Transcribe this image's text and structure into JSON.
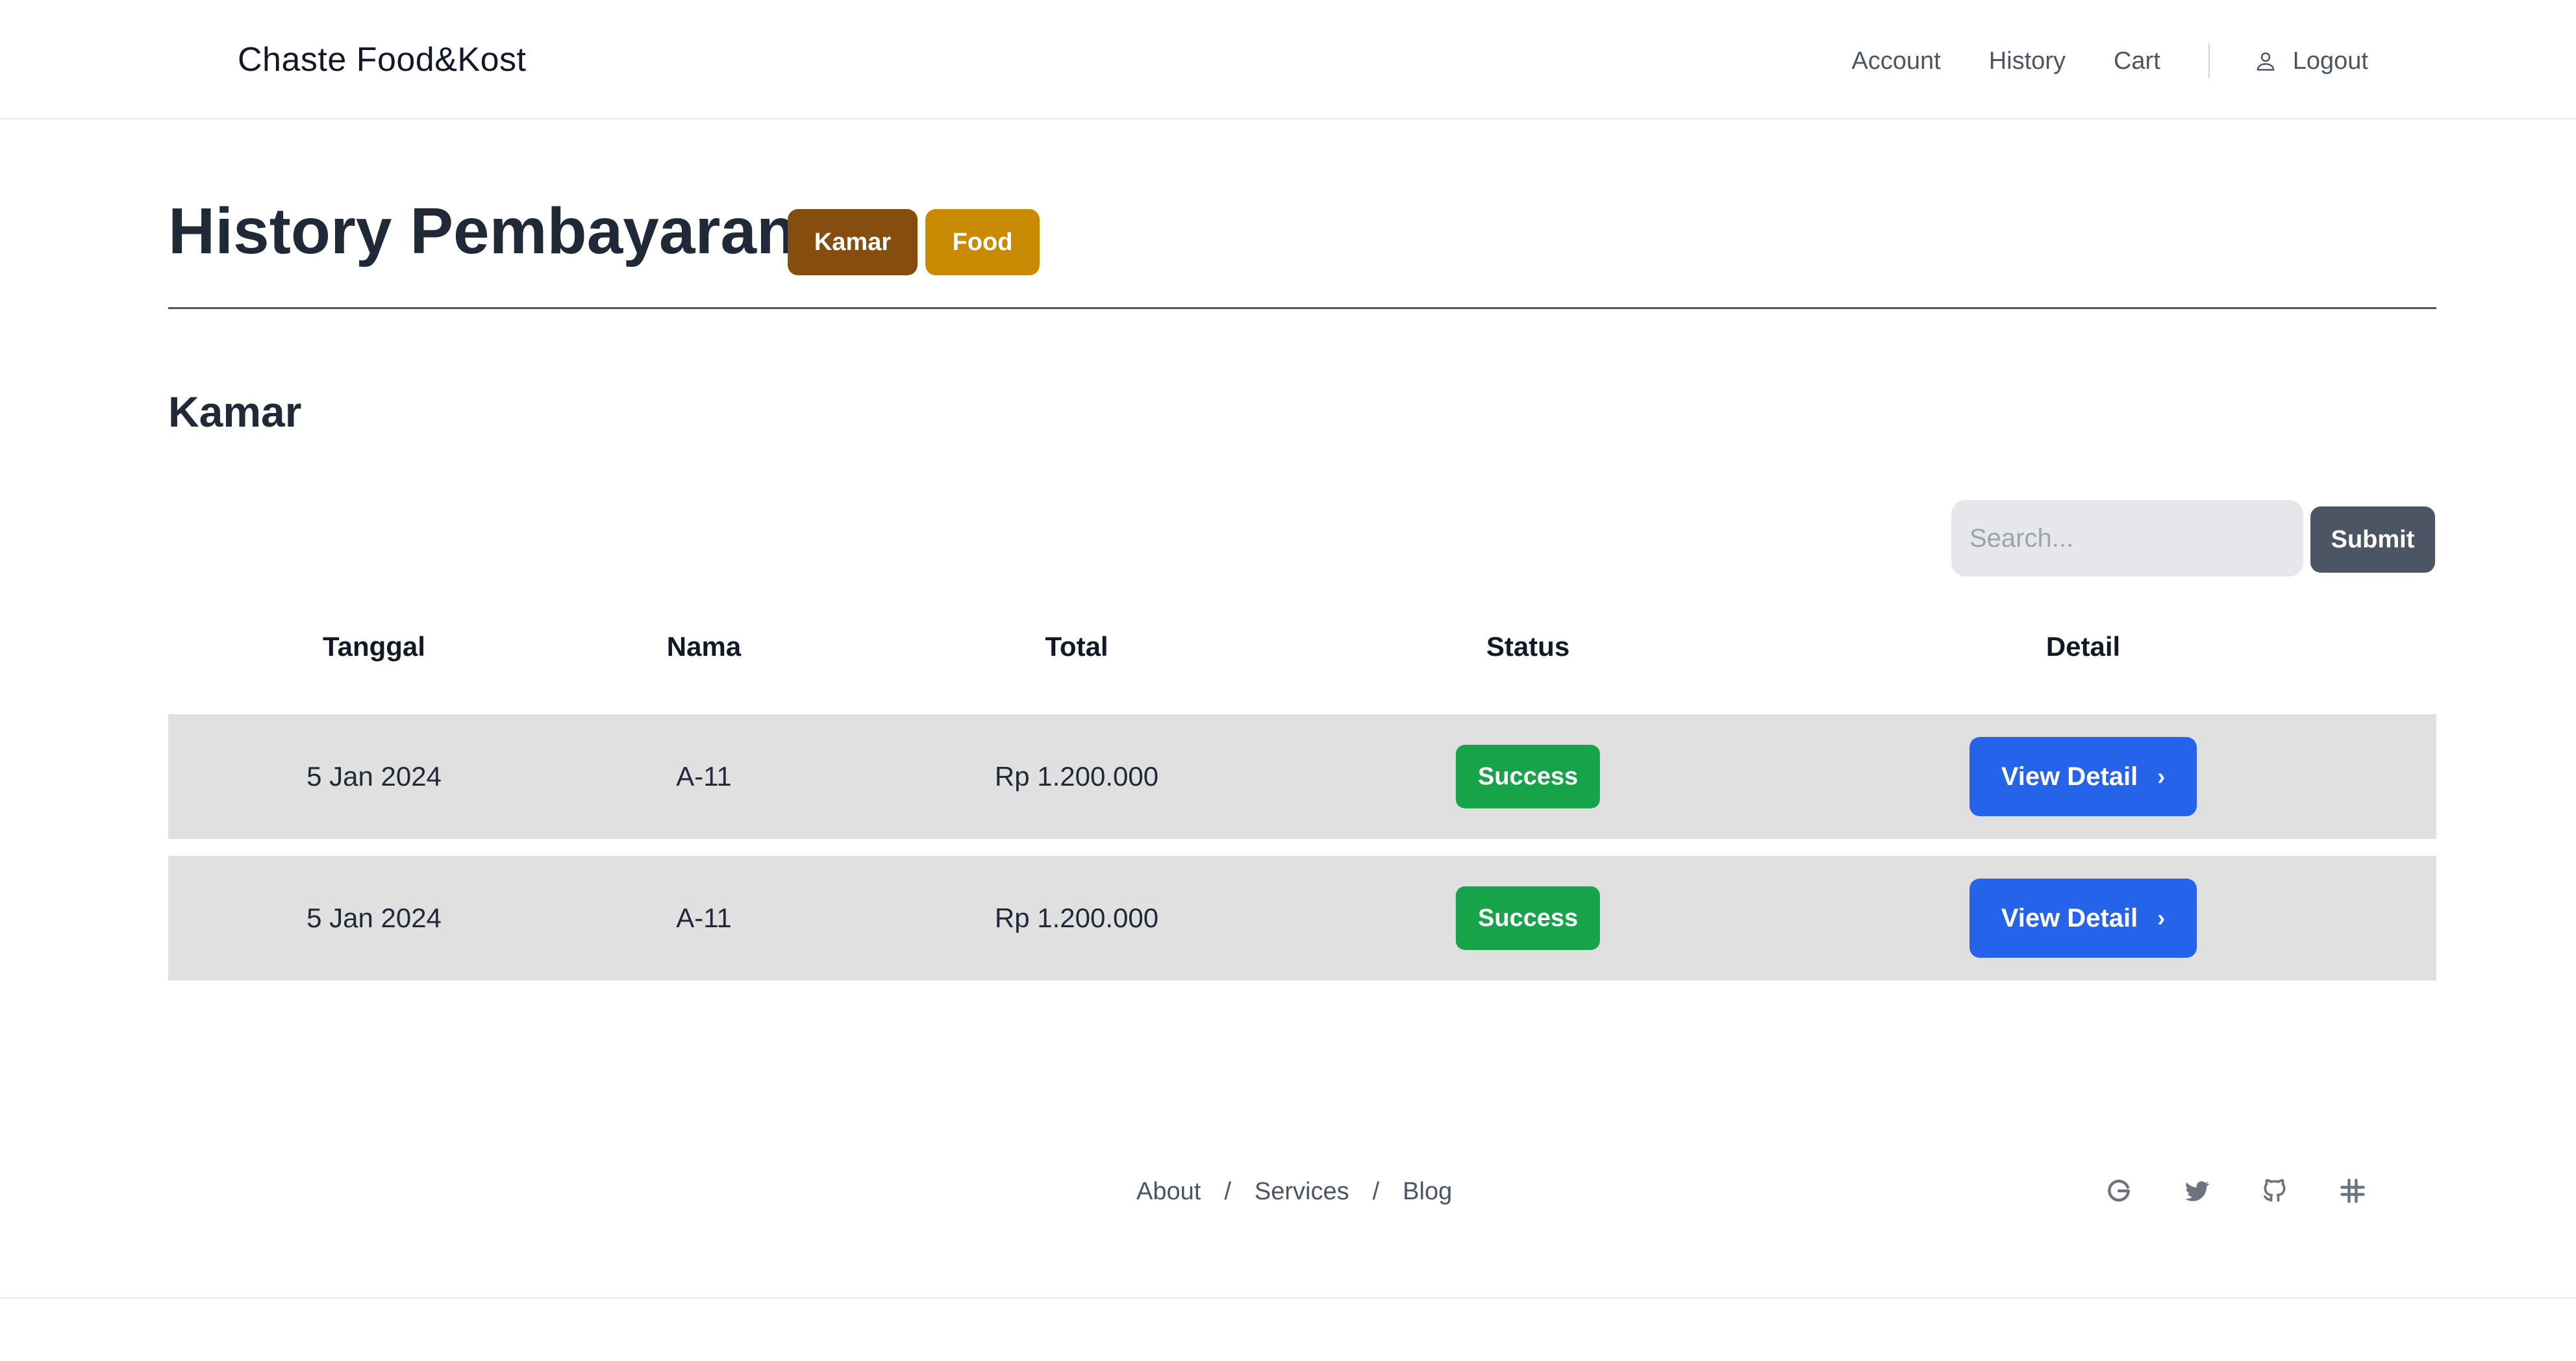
{
  "header": {
    "brand": "Chaste Food&Kost",
    "nav": [
      "Account",
      "History",
      "Cart"
    ],
    "logout": "Logout"
  },
  "page": {
    "title": "History Pembayaran",
    "tabs": [
      {
        "label": "Kamar",
        "color": "#854d0e"
      },
      {
        "label": "Food",
        "color": "#ca8a04"
      }
    ],
    "section_title": "Kamar"
  },
  "search": {
    "placeholder": "Search...",
    "value": "",
    "submit_label": "Submit"
  },
  "table": {
    "columns": [
      "Tanggal",
      "Nama",
      "Total",
      "Status",
      "Detail"
    ],
    "rows": [
      {
        "tanggal": "5 Jan 2024",
        "nama": "A-11",
        "total": "Rp 1.200.000",
        "status": "Success",
        "detail": "View Detail"
      },
      {
        "tanggal": "5 Jan 2024",
        "nama": "A-11",
        "total": "Rp 1.200.000",
        "status": "Success",
        "detail": "View Detail"
      }
    ]
  },
  "footer": {
    "links": [
      "About",
      "Services",
      "Blog"
    ],
    "separator": "/",
    "socials": [
      "google-icon",
      "twitter-icon",
      "github-icon",
      "slack-icon"
    ]
  },
  "colors": {
    "primary": "#2563eb",
    "success": "#16a34a",
    "submit": "#4b5563",
    "row_bg": "#e0e0e0"
  }
}
